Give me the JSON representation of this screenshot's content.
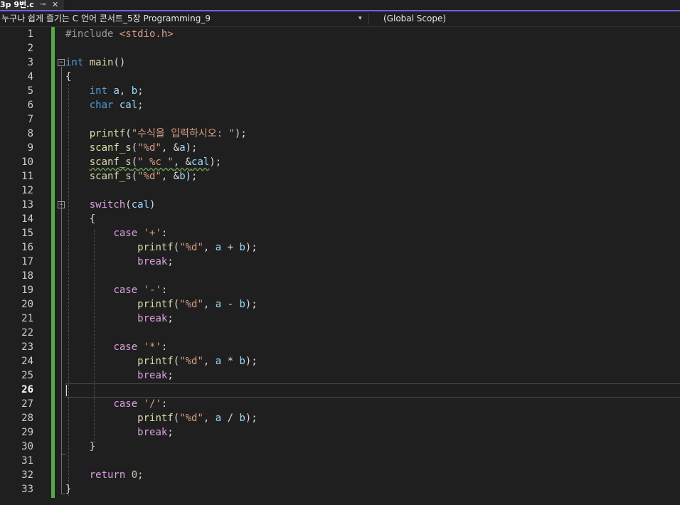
{
  "tab": {
    "title": "3p 9번.c",
    "pin_icon": "pin-icon",
    "close_icon": "close-icon",
    "pin_glyph": "⊸",
    "close_glyph": "✕"
  },
  "navbar": {
    "project": "누구나 쉽게 즐기는 C 언어 콘서트_5장 Programming_9",
    "dropdown_glyph": "▾",
    "scope": "(Global Scope)"
  },
  "editor": {
    "current_line": 26,
    "line_numbers": [
      "1",
      "2",
      "3",
      "4",
      "5",
      "6",
      "7",
      "8",
      "9",
      "10",
      "11",
      "12",
      "13",
      "14",
      "15",
      "16",
      "17",
      "18",
      "19",
      "20",
      "21",
      "22",
      "23",
      "24",
      "25",
      "26",
      "27",
      "28",
      "29",
      "30",
      "31",
      "32",
      "33"
    ],
    "fold_glyph": "−",
    "lines": [
      [
        {
          "t": "#include ",
          "c": "pre"
        },
        {
          "t": "<stdio.h>",
          "c": "inc"
        }
      ],
      [],
      [
        {
          "t": "int",
          "c": "kw"
        },
        {
          "t": " "
        },
        {
          "t": "main",
          "c": "fn"
        },
        {
          "t": "()",
          "c": "pun"
        }
      ],
      [
        {
          "t": "{",
          "c": "pun"
        }
      ],
      [
        {
          "t": "    "
        },
        {
          "t": "int",
          "c": "kw"
        },
        {
          "t": " "
        },
        {
          "t": "a",
          "c": "var"
        },
        {
          "t": ", "
        },
        {
          "t": "b",
          "c": "var"
        },
        {
          "t": ";"
        }
      ],
      [
        {
          "t": "    "
        },
        {
          "t": "char",
          "c": "kw"
        },
        {
          "t": " "
        },
        {
          "t": "cal",
          "c": "var"
        },
        {
          "t": ";"
        }
      ],
      [],
      [
        {
          "t": "    "
        },
        {
          "t": "printf",
          "c": "fn"
        },
        {
          "t": "("
        },
        {
          "t": "\"수식을 입력하시오: \"",
          "c": "str"
        },
        {
          "t": ");"
        }
      ],
      [
        {
          "t": "    "
        },
        {
          "t": "scanf_s",
          "c": "fn"
        },
        {
          "t": "("
        },
        {
          "t": "\"%d\"",
          "c": "str"
        },
        {
          "t": ", &"
        },
        {
          "t": "a",
          "c": "var"
        },
        {
          "t": ");"
        }
      ],
      [
        {
          "t": "    "
        },
        {
          "t": "scanf_s",
          "c": "fn",
          "s": 1
        },
        {
          "t": "(",
          "s": 1
        },
        {
          "t": "\" %c \"",
          "c": "str",
          "s": 1
        },
        {
          "t": ", &",
          "s": 1
        },
        {
          "t": "cal",
          "c": "var",
          "s": 1
        },
        {
          "t": ");"
        }
      ],
      [
        {
          "t": "    "
        },
        {
          "t": "scanf_s",
          "c": "fn"
        },
        {
          "t": "("
        },
        {
          "t": "\"%d\"",
          "c": "str"
        },
        {
          "t": ", &"
        },
        {
          "t": "b",
          "c": "var"
        },
        {
          "t": ");"
        }
      ],
      [],
      [
        {
          "t": "    "
        },
        {
          "t": "switch",
          "c": "ctl"
        },
        {
          "t": "("
        },
        {
          "t": "cal",
          "c": "var"
        },
        {
          "t": ")"
        }
      ],
      [
        {
          "t": "    {"
        }
      ],
      [
        {
          "t": "        "
        },
        {
          "t": "case",
          "c": "ctl"
        },
        {
          "t": " "
        },
        {
          "t": "'+'",
          "c": "str"
        },
        {
          "t": ":"
        }
      ],
      [
        {
          "t": "            "
        },
        {
          "t": "printf",
          "c": "fn"
        },
        {
          "t": "("
        },
        {
          "t": "\"%d\"",
          "c": "str"
        },
        {
          "t": ", "
        },
        {
          "t": "a",
          "c": "var"
        },
        {
          "t": " + "
        },
        {
          "t": "b",
          "c": "var"
        },
        {
          "t": ");"
        }
      ],
      [
        {
          "t": "            "
        },
        {
          "t": "break",
          "c": "ctl"
        },
        {
          "t": ";"
        }
      ],
      [],
      [
        {
          "t": "        "
        },
        {
          "t": "case",
          "c": "ctl"
        },
        {
          "t": " "
        },
        {
          "t": "'-'",
          "c": "str"
        },
        {
          "t": ":"
        }
      ],
      [
        {
          "t": "            "
        },
        {
          "t": "printf",
          "c": "fn"
        },
        {
          "t": "("
        },
        {
          "t": "\"%d\"",
          "c": "str"
        },
        {
          "t": ", "
        },
        {
          "t": "a",
          "c": "var"
        },
        {
          "t": " - "
        },
        {
          "t": "b",
          "c": "var"
        },
        {
          "t": ");"
        }
      ],
      [
        {
          "t": "            "
        },
        {
          "t": "break",
          "c": "ctl"
        },
        {
          "t": ";"
        }
      ],
      [],
      [
        {
          "t": "        "
        },
        {
          "t": "case",
          "c": "ctl"
        },
        {
          "t": " "
        },
        {
          "t": "'*'",
          "c": "str"
        },
        {
          "t": ":"
        }
      ],
      [
        {
          "t": "            "
        },
        {
          "t": "printf",
          "c": "fn"
        },
        {
          "t": "("
        },
        {
          "t": "\"%d\"",
          "c": "str"
        },
        {
          "t": ", "
        },
        {
          "t": "a",
          "c": "var"
        },
        {
          "t": " * "
        },
        {
          "t": "b",
          "c": "var"
        },
        {
          "t": ");"
        }
      ],
      [
        {
          "t": "            "
        },
        {
          "t": "break",
          "c": "ctl"
        },
        {
          "t": ";"
        }
      ],
      [],
      [
        {
          "t": "        "
        },
        {
          "t": "case",
          "c": "ctl"
        },
        {
          "t": " "
        },
        {
          "t": "'/'",
          "c": "str"
        },
        {
          "t": ":"
        }
      ],
      [
        {
          "t": "            "
        },
        {
          "t": "printf",
          "c": "fn"
        },
        {
          "t": "("
        },
        {
          "t": "\"%d\"",
          "c": "str"
        },
        {
          "t": ", "
        },
        {
          "t": "a",
          "c": "var"
        },
        {
          "t": " / "
        },
        {
          "t": "b",
          "c": "var"
        },
        {
          "t": ");"
        }
      ],
      [
        {
          "t": "            "
        },
        {
          "t": "break",
          "c": "ctl"
        },
        {
          "t": ";"
        }
      ],
      [
        {
          "t": "    }"
        }
      ],
      [],
      [
        {
          "t": "    "
        },
        {
          "t": "return",
          "c": "ctl"
        },
        {
          "t": " "
        },
        {
          "t": "0",
          "c": "num"
        },
        {
          "t": ";"
        }
      ],
      [
        {
          "t": "}"
        }
      ]
    ]
  },
  "colors": {
    "background": "#1f1f1f",
    "change_bar": "#57a64a",
    "keyword": "#569cd6",
    "control": "#d8a0df",
    "function": "#dcdcaa",
    "variable": "#9cdcfe",
    "string": "#d69d85",
    "number": "#b5cea8",
    "tab_accent": "#7160e8"
  }
}
